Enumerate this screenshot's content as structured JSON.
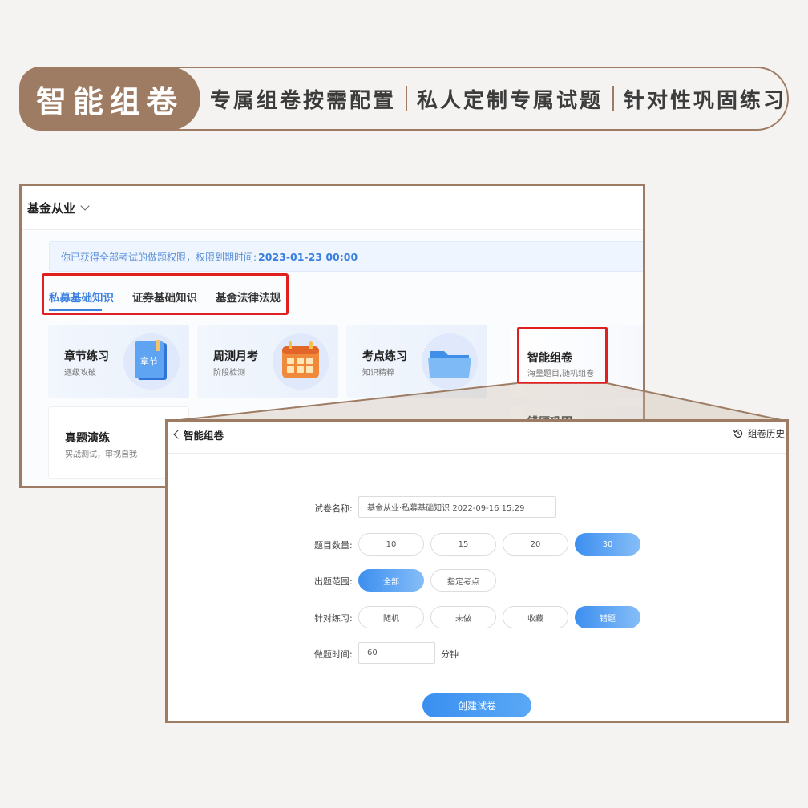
{
  "banner": {
    "title": "智能组卷",
    "items": [
      "专属组卷按需配置",
      "私人定制专属试题",
      "针对性巩固练习"
    ]
  },
  "main_screen": {
    "subject": "基金从业",
    "notice_text": "你已获得全部考试的做题权限，权限到期时间:",
    "notice_date": "2023-01-23 00:00",
    "tabs": [
      {
        "label": "私募基础知识",
        "active": true
      },
      {
        "label": "证券基础知识",
        "active": false
      },
      {
        "label": "基金法律法规",
        "active": false
      }
    ],
    "cards": [
      {
        "title": "章节练习",
        "subtitle": "逐级攻破",
        "icon": "book-icon",
        "icon_text": "章节"
      },
      {
        "title": "周测月考",
        "subtitle": "阶段检测",
        "icon": "calendar-icon"
      },
      {
        "title": "考点练习",
        "subtitle": "知识精粹",
        "icon": "folder-icon"
      },
      {
        "title": "智能组卷",
        "subtitle": "海量题目,随机组卷"
      },
      {
        "title": "真题演练",
        "subtitle": "实战测试，审视自我"
      },
      {
        "title": "错题巩固",
        "subtitle": ""
      }
    ]
  },
  "compose_screen": {
    "title": "智能组卷",
    "history_label": "组卷历史",
    "fields": {
      "name_label": "试卷名称:",
      "name_value": "基金从业·私募基础知识 2022-09-16 15:29",
      "count_label": "题目数量:",
      "count_options": [
        "10",
        "15",
        "20",
        "30"
      ],
      "count_selected": "30",
      "scope_label": "出题范围:",
      "scope_options": [
        "全部",
        "指定考点"
      ],
      "scope_selected": "全部",
      "target_label": "针对练习:",
      "target_options": [
        "随机",
        "未做",
        "收藏",
        "错题"
      ],
      "target_selected": "错题",
      "time_label": "做题时间:",
      "time_value": "60",
      "time_unit": "分钟"
    },
    "create_button": "创建试卷"
  },
  "colors": {
    "accent_brown": "#9e7b63",
    "primary_blue": "#3a8ff0",
    "highlight_red": "#e02020"
  }
}
